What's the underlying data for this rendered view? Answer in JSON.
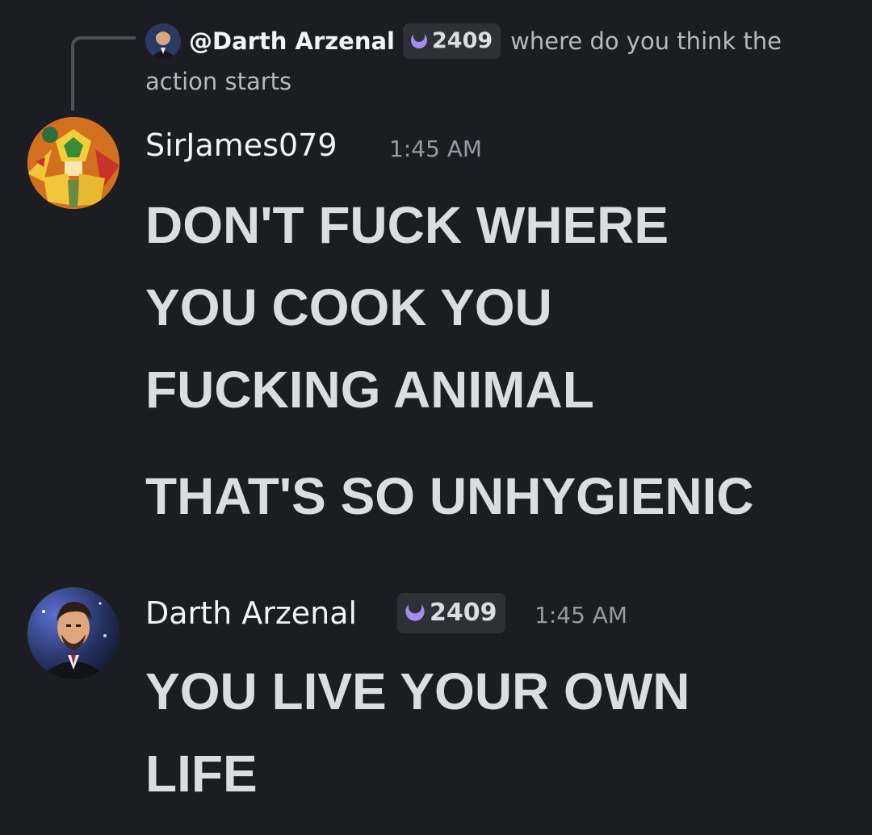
{
  "reply": {
    "mention": "@Darth Arzenal",
    "badge_count": "2409",
    "text": "where do you think the action starts"
  },
  "messages": [
    {
      "username": "SirJames079",
      "timestamp": "1:45 AM",
      "lines": [
        "DON'T FUCK WHERE",
        "YOU COOK YOU",
        "FUCKING ANIMAL"
      ],
      "followup": "THAT'S SO UNHYGIENIC"
    },
    {
      "username": "Darth Arzenal",
      "badge_count": "2409",
      "timestamp": "1:45 AM",
      "lines": [
        "YOU LIVE YOUR OWN",
        "LIFE"
      ]
    }
  ],
  "colors": {
    "background": "#1c1d22",
    "badge_bg": "#2e3036",
    "badge_icon": "#a48cf0",
    "text": "#dbdee1",
    "muted": "#949ba4"
  },
  "icons": {
    "badge": "crescent-moon-icon"
  }
}
